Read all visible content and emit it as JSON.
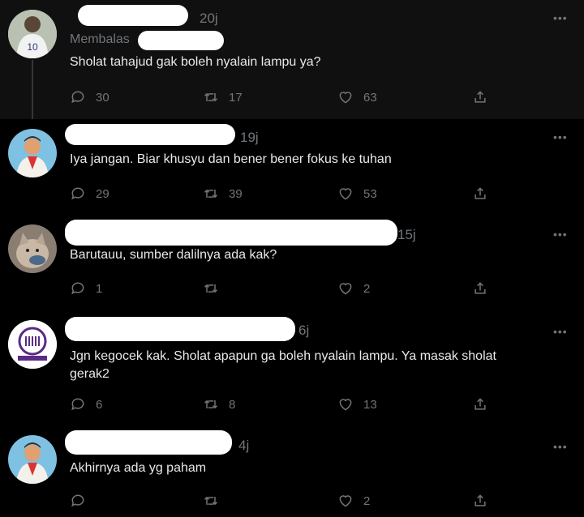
{
  "tweets": [
    {
      "time": "20j",
      "reply_to": "Membalas",
      "text": "Sholat tahajud gak boleh nyalain lampu ya?",
      "replies": "30",
      "retweets": "17",
      "likes": "63",
      "more": "•••"
    },
    {
      "time": "19j",
      "text": "Iya jangan.  Biar khusyu dan bener bener fokus ke tuhan",
      "replies": "29",
      "retweets": "39",
      "likes": "53",
      "more": "•••"
    },
    {
      "time": "15j",
      "text": "Barutauu, sumber dalilnya ada kak?",
      "replies": "1",
      "retweets": "",
      "likes": "2",
      "more": "•••"
    },
    {
      "time": "6j",
      "text": "Jgn kegocek kak. Sholat apapun ga  boleh nyalain lampu. Ya masak sholat gerak2",
      "replies": "6",
      "retweets": "8",
      "likes": "13",
      "more": "•••"
    },
    {
      "time": "4j",
      "text": "Akhirnya ada yg paham",
      "replies": "",
      "retweets": "",
      "likes": "2",
      "more": "•••"
    }
  ],
  "avatar_icons": [
    "jersey-player-avatar-icon",
    "cartoon-man-avatar-icon",
    "cat-avatar-icon",
    "purple-logo-avatar-icon",
    "cartoon-man-avatar-icon"
  ],
  "colors": {
    "background": "#000000",
    "text": "#e7e9ea",
    "muted": "#71767b",
    "redaction": "#ffffff",
    "thread_line": "#333639"
  }
}
